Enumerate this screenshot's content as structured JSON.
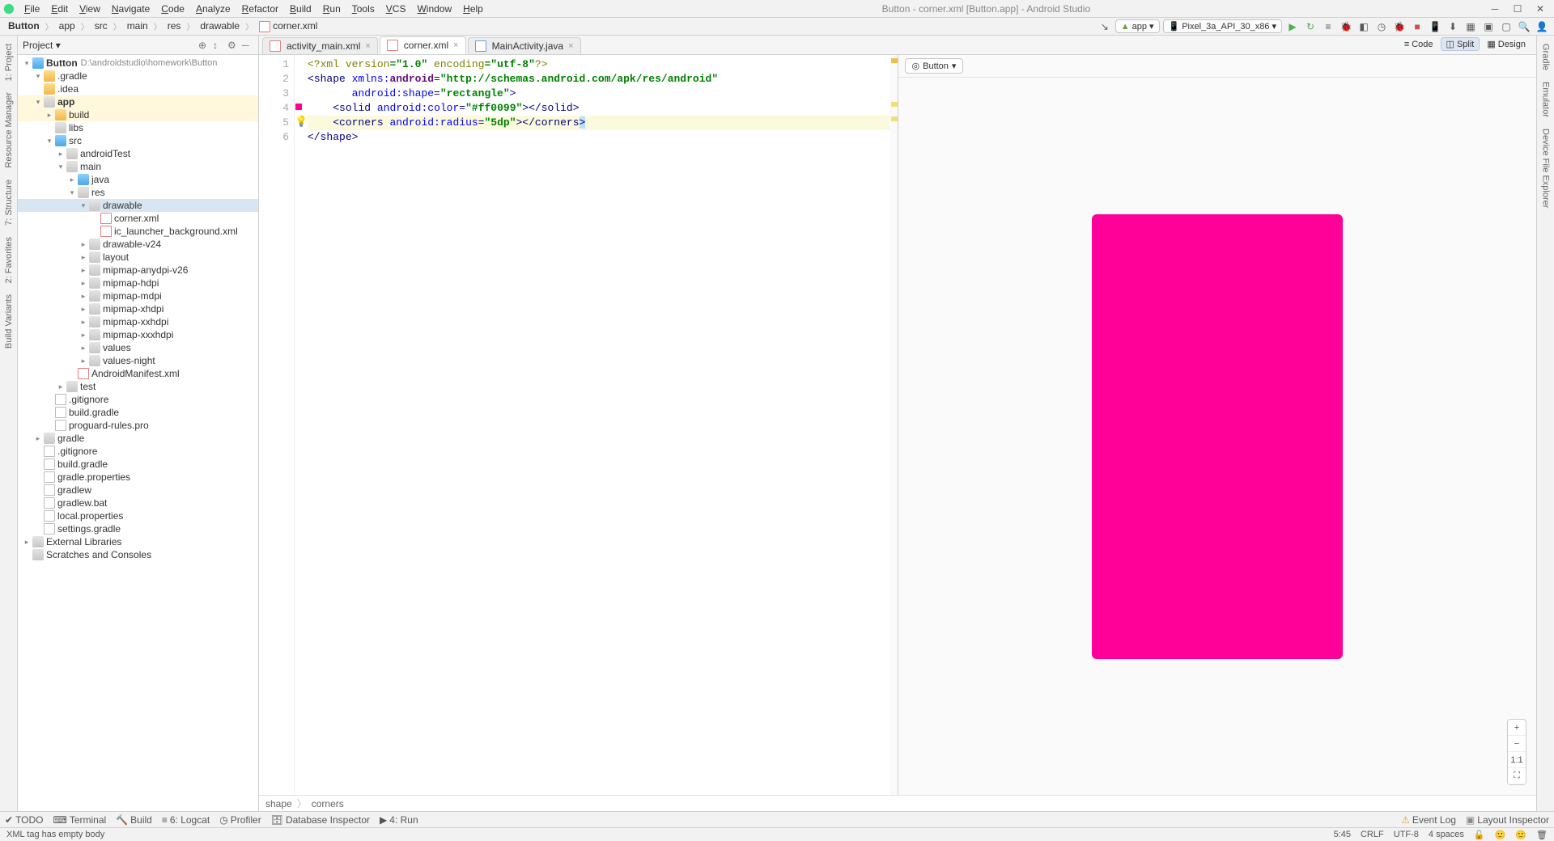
{
  "window": {
    "title": "Button - corner.xml [Button.app] - Android Studio"
  },
  "menu": [
    "File",
    "Edit",
    "View",
    "Navigate",
    "Code",
    "Analyze",
    "Refactor",
    "Build",
    "Run",
    "Tools",
    "VCS",
    "Window",
    "Help"
  ],
  "breadcrumbs": [
    {
      "label": "Button",
      "bold": true
    },
    {
      "label": "app",
      "bold": false
    },
    {
      "label": "src",
      "bold": false
    },
    {
      "label": "main",
      "bold": false
    },
    {
      "label": "res",
      "bold": false
    },
    {
      "label": "drawable",
      "bold": false
    },
    {
      "label": "corner.xml",
      "bold": false,
      "icon": "file-xml"
    }
  ],
  "runConfig": {
    "module": "app",
    "device": "Pixel_3a_API_30_x86"
  },
  "projectPanel": {
    "title": "Project"
  },
  "tree": {
    "root": {
      "label": "Button",
      "path": "D:\\androidstudio\\homework\\Button"
    },
    "items": [
      {
        "indent": 1,
        "tw": "▾",
        "ic": "folder-open",
        "label": ".gradle"
      },
      {
        "indent": 1,
        "tw": "",
        "ic": "folder-open",
        "label": ".idea"
      },
      {
        "indent": 1,
        "tw": "▾",
        "ic": "folder",
        "label": "app",
        "bold": true,
        "highlight": true
      },
      {
        "indent": 2,
        "tw": "▸",
        "ic": "folder-open",
        "label": "build",
        "highlight": true
      },
      {
        "indent": 2,
        "tw": "",
        "ic": "folder",
        "label": "libs"
      },
      {
        "indent": 2,
        "tw": "▾",
        "ic": "folder-blue",
        "label": "src"
      },
      {
        "indent": 3,
        "tw": "▸",
        "ic": "folder",
        "label": "androidTest"
      },
      {
        "indent": 3,
        "tw": "▾",
        "ic": "folder",
        "label": "main"
      },
      {
        "indent": 4,
        "tw": "▸",
        "ic": "folder-blue",
        "label": "java"
      },
      {
        "indent": 4,
        "tw": "▾",
        "ic": "folder",
        "label": "res"
      },
      {
        "indent": 5,
        "tw": "▾",
        "ic": "folder",
        "label": "drawable",
        "selected": true
      },
      {
        "indent": 6,
        "tw": "",
        "ic": "file-xml",
        "label": "corner.xml"
      },
      {
        "indent": 6,
        "tw": "",
        "ic": "file-xml",
        "label": "ic_launcher_background.xml"
      },
      {
        "indent": 5,
        "tw": "▸",
        "ic": "folder",
        "label": "drawable-v24"
      },
      {
        "indent": 5,
        "tw": "▸",
        "ic": "folder",
        "label": "layout"
      },
      {
        "indent": 5,
        "tw": "▸",
        "ic": "folder",
        "label": "mipmap-anydpi-v26"
      },
      {
        "indent": 5,
        "tw": "▸",
        "ic": "folder",
        "label": "mipmap-hdpi"
      },
      {
        "indent": 5,
        "tw": "▸",
        "ic": "folder",
        "label": "mipmap-mdpi"
      },
      {
        "indent": 5,
        "tw": "▸",
        "ic": "folder",
        "label": "mipmap-xhdpi"
      },
      {
        "indent": 5,
        "tw": "▸",
        "ic": "folder",
        "label": "mipmap-xxhdpi"
      },
      {
        "indent": 5,
        "tw": "▸",
        "ic": "folder",
        "label": "mipmap-xxxhdpi"
      },
      {
        "indent": 5,
        "tw": "▸",
        "ic": "folder",
        "label": "values"
      },
      {
        "indent": 5,
        "tw": "▸",
        "ic": "folder",
        "label": "values-night"
      },
      {
        "indent": 4,
        "tw": "",
        "ic": "file-xml",
        "label": "AndroidManifest.xml"
      },
      {
        "indent": 3,
        "tw": "▸",
        "ic": "folder",
        "label": "test"
      },
      {
        "indent": 2,
        "tw": "",
        "ic": "file",
        "label": ".gitignore"
      },
      {
        "indent": 2,
        "tw": "",
        "ic": "file",
        "label": "build.gradle"
      },
      {
        "indent": 2,
        "tw": "",
        "ic": "file",
        "label": "proguard-rules.pro"
      },
      {
        "indent": 1,
        "tw": "▸",
        "ic": "folder",
        "label": "gradle"
      },
      {
        "indent": 1,
        "tw": "",
        "ic": "file",
        "label": ".gitignore"
      },
      {
        "indent": 1,
        "tw": "",
        "ic": "file",
        "label": "build.gradle"
      },
      {
        "indent": 1,
        "tw": "",
        "ic": "file",
        "label": "gradle.properties"
      },
      {
        "indent": 1,
        "tw": "",
        "ic": "file",
        "label": "gradlew"
      },
      {
        "indent": 1,
        "tw": "",
        "ic": "file",
        "label": "gradlew.bat"
      },
      {
        "indent": 1,
        "tw": "",
        "ic": "file",
        "label": "local.properties"
      },
      {
        "indent": 1,
        "tw": "",
        "ic": "file",
        "label": "settings.gradle"
      },
      {
        "indent": 0,
        "tw": "▸",
        "ic": "folder",
        "label": "External Libraries"
      },
      {
        "indent": 0,
        "tw": "",
        "ic": "folder",
        "label": "Scratches and Consoles"
      }
    ]
  },
  "editorTabs": [
    {
      "label": "activity_main.xml",
      "icon": "file-xml",
      "active": false
    },
    {
      "label": "corner.xml",
      "icon": "file-xml",
      "active": true
    },
    {
      "label": "MainActivity.java",
      "icon": "file-java",
      "active": false
    }
  ],
  "viewModes": {
    "code": "Code",
    "split": "Split",
    "design": "Design"
  },
  "code": {
    "lineCount": 6,
    "declaration": {
      "pre": "<?",
      "xml": "xml version",
      "v": "=\"1.0\" ",
      "enc": "encoding",
      "ev": "=\"utf-8\"",
      "post": "?>"
    },
    "shape_open": "<",
    "shape_tag": "shape",
    "xmlns": " xmlns:",
    "android_ns": "android",
    "eq": "=",
    "ns_url": "\"http://schemas.android.com/apk/res/android\"",
    "shape_attr": "android:shape",
    "shape_val": "\"rectangle\"",
    "close": ">",
    "solid_tag": "solid",
    "color_attr": "android:color",
    "color_val": "\"#ff0099\"",
    "solid_close": "></",
    "solid_end": ">",
    "corners_tag": "corners",
    "radius_attr": "android:radius",
    "radius_val": "\"5dp\"",
    "corners_close": "></",
    "corners_end": ">",
    "shape_close": "</",
    "shape_close_end": ">"
  },
  "preview": {
    "dropdown": "Button",
    "color": "#ff0099"
  },
  "editorBreadcrumb": [
    "shape",
    "corners"
  ],
  "bottomTools": [
    "TODO",
    "Terminal",
    "Build",
    "Logcat",
    "Profiler",
    "Database Inspector",
    "Run"
  ],
  "bottomRight": [
    "Event Log",
    "Layout Inspector"
  ],
  "status": {
    "msg": "XML tag has empty body",
    "pos": "5:45",
    "sep": "CRLF",
    "enc": "UTF-8",
    "indent": "4 spaces"
  },
  "sideTabsLeft": [
    "1: Project",
    "Resource Manager",
    "7: Structure",
    "2: Favorites",
    "Build Variants"
  ],
  "sideTabsRight": [
    "Gradle",
    "Emulator",
    "Device File Explorer"
  ]
}
